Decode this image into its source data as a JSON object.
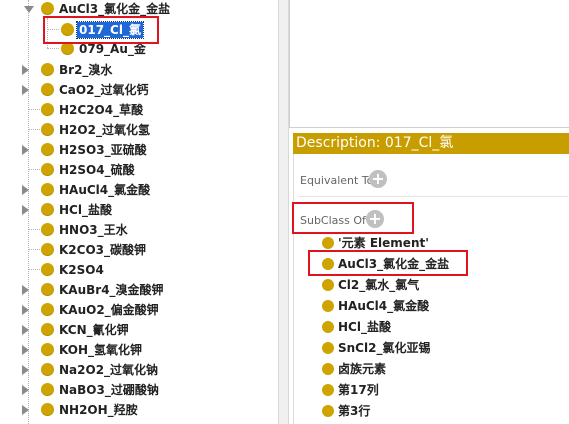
{
  "tree": {
    "rows": [
      {
        "label": "AuCl3_氯化金_金盐",
        "expanded": true
      },
      {
        "label": "017_Cl_氯",
        "selected": true
      },
      {
        "label": "079_Au_金"
      },
      {
        "label": "Br2_溴水"
      },
      {
        "label": "CaO2_过氧化钙"
      },
      {
        "label": "H2C2O4_草酸"
      },
      {
        "label": "H2O2_过氧化氢"
      },
      {
        "label": "H2SO3_亚硫酸"
      },
      {
        "label": "H2SO4_硫酸"
      },
      {
        "label": "HAuCl4_氯金酸"
      },
      {
        "label": "HCl_盐酸"
      },
      {
        "label": "HNO3_王水"
      },
      {
        "label": "K2CO3_碳酸钾"
      },
      {
        "label": "K2SO4"
      },
      {
        "label": "KAuBr4_溴金酸钾"
      },
      {
        "label": "KAuO2_偏金酸钾"
      },
      {
        "label": "KCN_氰化钾"
      },
      {
        "label": "KOH_氢氧化钾"
      },
      {
        "label": "Na2O2_过氧化钠"
      },
      {
        "label": "NaBO3_过硼酸钠"
      },
      {
        "label": "NH2OH_羟胺"
      }
    ]
  },
  "description": {
    "header": "Description: 017_Cl_氯",
    "equivalent_to_label": "Equivalent To",
    "subclass_of_label": "SubClass Of",
    "subclass_items": [
      "'元素 Element'",
      "AuCl3_氯化金_金盐",
      "Cl2_氯水_氯气",
      "HAuCl4_氯金酸",
      "HCl_盐酸",
      "SnCl2_氯化亚锡",
      "卤族元素",
      "第17列",
      "第3行"
    ]
  },
  "colors": {
    "accent_gold": "#c89d00",
    "bullet_gold": "#cfa400",
    "selection_blue": "#1e68d8",
    "highlight_red": "#e0141e"
  },
  "icons": {
    "tree_toggle": "triangle-right-icon",
    "class_bullet": "class-circle-icon",
    "add": "plus-circle-icon"
  }
}
